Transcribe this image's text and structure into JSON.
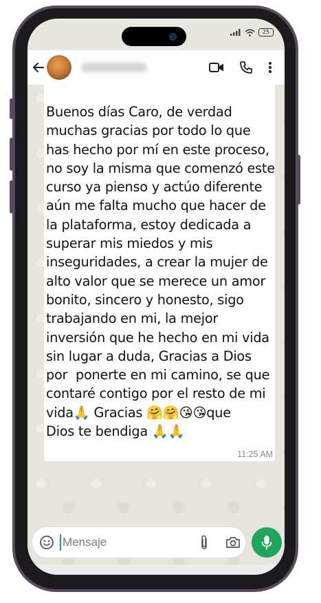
{
  "status_bar": {
    "battery_level": "25"
  },
  "header": {
    "back_icon": "arrow-left-icon",
    "video_icon": "video-camera-icon",
    "call_icon": "phone-icon",
    "menu_icon": "more-vertical-icon"
  },
  "message": {
    "lines": [
      "Buenos días Caro, de verdad",
      "muchas gracias por todo lo que",
      "has hecho por mí en este proceso,",
      "no soy la misma que comenzó este",
      "curso ya pienso y actúo diferente",
      "aún me falta mucho que hacer de",
      "la plataforma, estoy dedicada a",
      "superar mis miedos y mis",
      "inseguridades, a crear la mujer de",
      "alto valor que se merece un amor",
      "bonito, sincero y honesto, sigo",
      "trabajando en mi, la mejor",
      "inversión que he hecho en mi vida",
      "sin lugar a duda, Gracias a Dios",
      "por  ponerte en mi camino, se que",
      "contaré contigo por el resto de mi",
      "vida🙏 Gracias 🤗🤗😘😘que",
      "Dios te bendiga 🙏🙏"
    ],
    "time": "11:25 AM"
  },
  "composer": {
    "placeholder": "Mensaje",
    "emoji_icon": "emoji-smiley-icon",
    "attach_icon": "paperclip-icon",
    "camera_icon": "camera-icon",
    "mic_icon": "microphone-icon"
  },
  "colors": {
    "frame": "#5a4960",
    "accent_green": "#1ea65d",
    "bubble": "#ffffff",
    "wallpaper": "#e7e4dc"
  }
}
